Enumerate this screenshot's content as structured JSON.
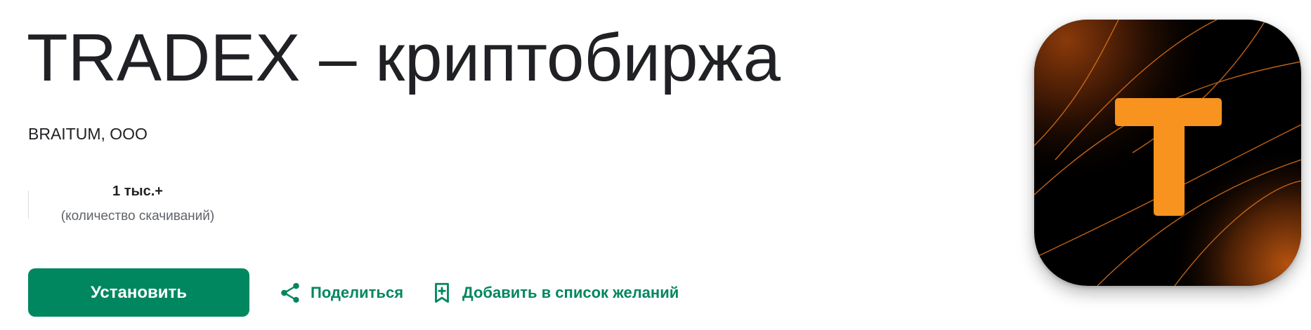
{
  "app": {
    "title": "TRADEX – криптобиржа",
    "developer": "BRAITUM, ООО"
  },
  "stats": {
    "downloads_value": "1 тыс.+",
    "downloads_label": "(количество скачиваний)"
  },
  "actions": {
    "install_label": "Установить",
    "share_label": "Поделиться",
    "wishlist_label": "Добавить в список желаний"
  },
  "icons": {
    "share": "share-icon",
    "wishlist": "bookmark-add-icon",
    "app": "tradex-app-icon"
  },
  "colors": {
    "accent": "#01875f",
    "title": "#202124",
    "muted": "#5f6368",
    "logo_orange": "#f7931e",
    "logo_background": "#000000"
  }
}
